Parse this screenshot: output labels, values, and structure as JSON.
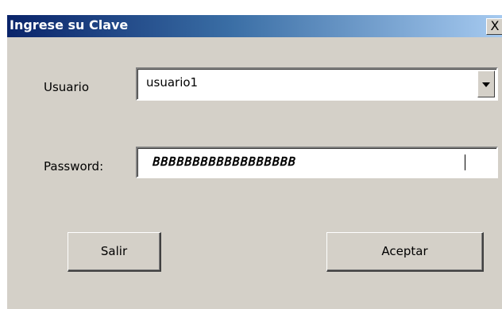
{
  "window": {
    "title": "Ingrese su Clave",
    "close_label": "X"
  },
  "form": {
    "user_label": "Usuario",
    "user_value": "usuario1",
    "password_label": "Password:",
    "password_value": "𝙱𝙱𝙱𝙱𝙱𝙱𝙱𝙱𝙱𝙱𝙱𝙱𝙱𝙱𝙱𝙱𝙱𝙱"
  },
  "buttons": {
    "exit_label": "Salir",
    "accept_label": "Aceptar"
  },
  "icons": {
    "combo_dropdown": "chevron-down-icon",
    "close": "close-icon"
  },
  "colors": {
    "titlebar_start": "#0a246a",
    "titlebar_end": "#a6caf0",
    "face": "#d4d0c8"
  }
}
